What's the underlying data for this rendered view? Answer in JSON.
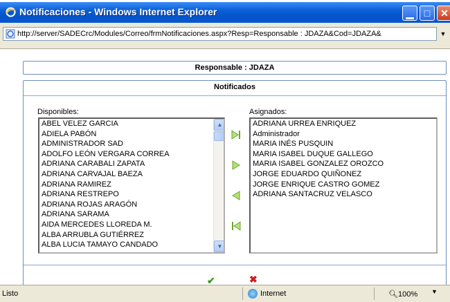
{
  "window": {
    "title": "Notificaciones - Windows Internet Explorer",
    "url": "http://server/SADECrc/Modules/Correo/frmNotificaciones.aspx?Resp=Responsable : JDAZA&Cod=JDAZA&"
  },
  "header": {
    "responsable": "Responsable : JDAZA",
    "section_title": "Notificados"
  },
  "disponibles": {
    "label": "Disponibles:",
    "items": [
      "ABEL VELEZ GARCIA",
      "ADIELA PABÓN",
      "ADMINISTRADOR SAD",
      "ADOLFO LEÓN VERGARA CORREA",
      "ADRIANA CARABALI ZAPATA",
      "ADRIANA CARVAJAL BAEZA",
      "ADRIANA RAMIREZ",
      "ADRIANA RESTREPO",
      "ADRIANA ROJAS ARAGÓN",
      "ADRIANA SARAMA",
      "AIDA MERCEDES LLOREDA M.",
      "ALBA ARRUBLA GUTIÉRREZ",
      "ALBA LUCIA TAMAYO CANDADO"
    ]
  },
  "asignados": {
    "label": "Asignados:",
    "items": [
      "ADRIANA URREA ENRIQUEZ",
      "Administrador",
      "MARIA INÉS PUSQUIN",
      "MARIA ISABEL DUQUE GALLEGO",
      "MARIA ISABEL GONZALEZ OROZCO",
      "JORGE EDUARDO QUIÑONEZ",
      "JORGE ENRIQUE CASTRO GOMEZ",
      "ADRIANA SANTACRUZ VELASCO"
    ]
  },
  "transfer_icons": [
    "move-all-right-icon",
    "move-right-icon",
    "move-left-icon",
    "move-all-left-icon"
  ],
  "statusbar": {
    "status": "Listo",
    "zone": "Internet",
    "zoom": "100%"
  },
  "colors": {
    "titlebar": "#0a5fd8",
    "panel_border": "#6b8fbf",
    "arrow_green": "#7ab83a",
    "ok_green": "#3a9a1d",
    "cancel_red": "#d21b1b"
  }
}
